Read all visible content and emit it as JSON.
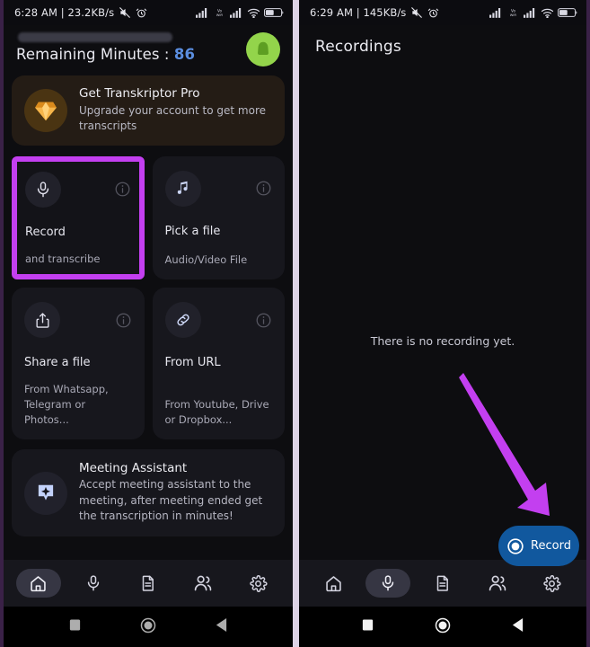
{
  "screen_left": {
    "statusbar": {
      "time_text": "6:28 AM | 23.2KB/s",
      "icons": [
        "mute-icon",
        "alarm-icon",
        "signal-bars-icon",
        "volte-icon",
        "signal-bars-2-icon",
        "wifi-icon",
        "battery-icon"
      ],
      "battery_level": "54"
    },
    "header": {
      "account_name_redacted": "",
      "remaining_label": "Remaining Minutes : ",
      "remaining_value": "86",
      "avatar_name": "user-avatar"
    },
    "promo": {
      "icon": "gem-icon",
      "title": "Get Transkriptor Pro",
      "subtitle": "Upgrade your account to get more transcripts"
    },
    "cards": [
      {
        "icon": "microphone-icon",
        "info_icon": "info-icon",
        "title": "Record",
        "subtitle": "and transcribe",
        "highlighted": true
      },
      {
        "icon": "music-note-icon",
        "info_icon": "info-icon",
        "title": "Pick a file",
        "subtitle": "Audio/Video File",
        "highlighted": false
      },
      {
        "icon": "share-icon",
        "info_icon": "info-icon",
        "title": "Share a file",
        "subtitle": "From Whatsapp, Telegram or Photos...",
        "highlighted": false
      },
      {
        "icon": "link-icon",
        "info_icon": "info-icon",
        "title": "From URL",
        "subtitle": "From Youtube, Drive or Dropbox...",
        "highlighted": false
      }
    ],
    "meeting": {
      "icon": "sparkle-bubble-icon",
      "title": "Meeting Assistant",
      "subtitle": "Accept meeting assistant to the meeting, after meeting ended get the transcription in minutes!"
    },
    "nav": {
      "active_index": 0,
      "items": [
        {
          "name": "home-icon",
          "label": "Home"
        },
        {
          "name": "microphone-icon",
          "label": "Record"
        },
        {
          "name": "document-icon",
          "label": "Files"
        },
        {
          "name": "people-icon",
          "label": "Team"
        },
        {
          "name": "gear-icon",
          "label": "Settings"
        }
      ]
    },
    "sysnav": [
      "recents-square-icon",
      "home-circle-icon",
      "back-triangle-icon"
    ]
  },
  "screen_right": {
    "statusbar": {
      "time_text": "6:29 AM | 145KB/s",
      "icons": [
        "mute-icon",
        "alarm-icon",
        "signal-bars-icon",
        "volte-icon",
        "signal-bars-2-icon",
        "wifi-icon",
        "battery-icon"
      ],
      "battery_level": "54"
    },
    "header": {
      "title": "Recordings"
    },
    "empty_state_text": "There is no recording yet.",
    "fab": {
      "icon": "record-dot-icon",
      "label": "Record",
      "color": "#11589e"
    },
    "nav": {
      "active_index": 1,
      "items": [
        {
          "name": "home-icon",
          "label": "Home"
        },
        {
          "name": "microphone-icon",
          "label": "Record"
        },
        {
          "name": "document-icon",
          "label": "Files"
        },
        {
          "name": "people-icon",
          "label": "Team"
        },
        {
          "name": "gear-icon",
          "label": "Settings"
        }
      ]
    },
    "sysnav": [
      "recents-square-icon",
      "home-circle-icon",
      "back-triangle-icon"
    ]
  },
  "annotation": {
    "arrow_color": "#c33ff0",
    "highlight_color": "#c33ff0"
  }
}
